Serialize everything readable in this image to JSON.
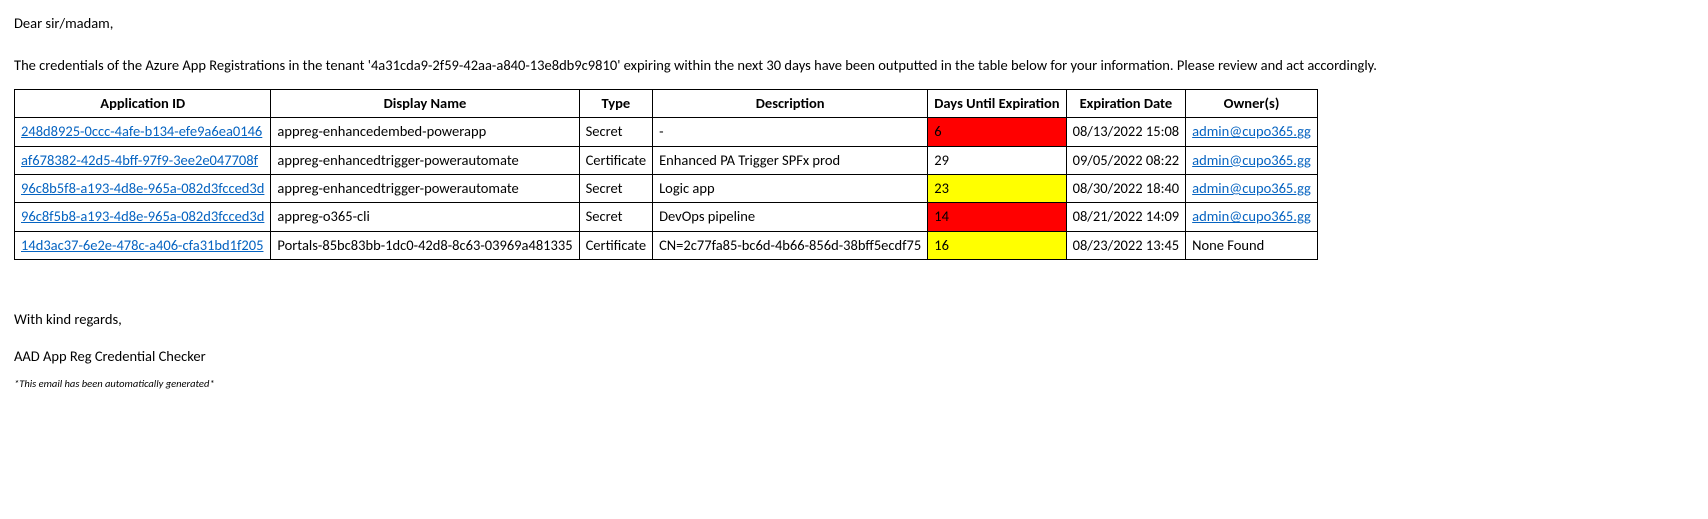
{
  "salutation": "Dear sir/madam,",
  "intro_prefix": "The credentials of the Azure App Registrations in the tenant '",
  "tenant_id": "4a31cda9-2f59-42aa-a840-13e8db9c9810",
  "intro_suffix": "' expiring within the next 30 days have been outputted in the table below for your information. Please review and act accordingly.",
  "headers": {
    "app_id": "Application ID",
    "display_name": "Display Name",
    "type": "Type",
    "description": "Description",
    "days_until": "Days Until Expiration",
    "exp_date": "Expiration Date",
    "owners": "Owner(s)"
  },
  "rows": [
    {
      "app_id": "248d8925-0ccc-4afe-b134-efe9a6ea0146",
      "display_name": "appreg-enhancedembed-powerapp",
      "type": "Secret",
      "description": "-",
      "days": "6",
      "days_class": "days-red",
      "exp_date": "08/13/2022 15:08",
      "owner": "admin@cupo365.gg",
      "owner_is_link": true
    },
    {
      "app_id": "af678382-42d5-4bff-97f9-3ee2e047708f",
      "display_name": "appreg-enhancedtrigger-powerautomate",
      "type": "Certificate",
      "description": "Enhanced PA Trigger SPFx prod",
      "days": "29",
      "days_class": "days-none",
      "exp_date": "09/05/2022 08:22",
      "owner": "admin@cupo365.gg",
      "owner_is_link": true
    },
    {
      "app_id": "96c8b5f8-a193-4d8e-965a-082d3fcced3d",
      "display_name": "appreg-enhancedtrigger-powerautomate",
      "type": "Secret",
      "description": "Logic app",
      "days": "23",
      "days_class": "days-yellow",
      "exp_date": "08/30/2022 18:40",
      "owner": "admin@cupo365.gg",
      "owner_is_link": true
    },
    {
      "app_id": "96c8f5b8-a193-4d8e-965a-082d3fcced3d",
      "display_name": "appreg-o365-cli",
      "type": "Secret",
      "description": "DevOps pipeline",
      "days": "14",
      "days_class": "days-red",
      "exp_date": "08/21/2022 14:09",
      "owner": "admin@cupo365.gg",
      "owner_is_link": true
    },
    {
      "app_id": "14d3ac37-6e2e-478c-a406-cfa31bd1f205",
      "display_name": "Portals-85bc83bb-1dc0-42d8-8c63-03969a481335",
      "type": "Certificate",
      "description": "CN=2c77fa85-bc6d-4b66-856d-38bff5ecdf75",
      "days": "16",
      "days_class": "days-yellow",
      "exp_date": "08/23/2022 13:45",
      "owner": "None Found",
      "owner_is_link": false
    }
  ],
  "regards": "With kind regards,",
  "signature": "AAD App Reg Credential Checker",
  "footnote": "*This email has been automatically generated*"
}
